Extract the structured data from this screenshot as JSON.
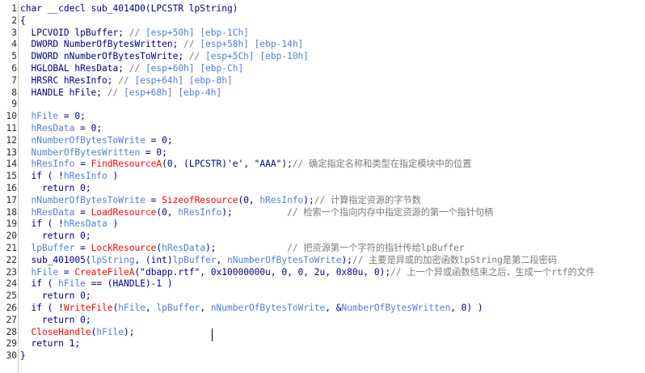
{
  "editor": {
    "lines": [
      "char __cdecl sub_4014D0(LPCSTR lpString)",
      "{",
      "  LPCVOID lpBuffer; // [esp+50h] [ebp-1Ch]",
      "  DWORD NumberOfBytesWritten; // [esp+58h] [ebp-14h]",
      "  DWORD nNumberOfBytesToWrite; // [esp+5Ch] [ebp-10h]",
      "  HGLOBAL hResData; // [esp+60h] [ebp-Ch]",
      "  HRSRC hResInfo; // [esp+64h] [ebp-8h]",
      "  HANDLE hFile; // [esp+68h] [ebp-4h]",
      "",
      "  hFile = 0;",
      "  hResData = 0;",
      "  nNumberOfBytesToWrite = 0;",
      "  NumberOfBytesWritten = 0;",
      "  hResInfo = FindResourceA(0, (LPCSTR)'e', \"AAA\");// 确定指定名称和类型在指定模块中的位置",
      "  if ( !hResInfo )",
      "    return 0;",
      "  nNumberOfBytesToWrite = SizeofResource(0, hResInfo);// 计算指定资源的字节数",
      "  hResData = LoadResource(0, hResInfo);          // 检索一个指向内存中指定资源的第一个指针句柄",
      "  if ( !hResData )",
      "    return 0;",
      "  lpBuffer = LockResource(hResData);             // 把资源第一个字符的指针传给lpBuffer",
      "  sub_401005(lpString, (int)lpBuffer, nNumberOfBytesToWrite);// 主要是异或的加密函数lpString是第二段密码",
      "  hFile = CreateFileA(\"dbapp.rtf\", 0x10000000u, 0, 0, 2u, 0x80u, 0);// 上一个异或函数结束之后，生成一个rtf的文件",
      "  if ( hFile == (HANDLE)-1 )",
      "    return 0;",
      "  if ( !WriteFile(hFile, lpBuffer, nNumberOfBytesToWrite, &NumberOfBytesWritten, 0) )",
      "    return 0;",
      "  CloseHandle(hFile);",
      "  return 1;",
      "}"
    ],
    "line_numbers": [
      "1",
      "2",
      "3",
      "4",
      "5",
      "6",
      "7",
      "8",
      "9",
      "10",
      "11",
      "12",
      "13",
      "14",
      "15",
      "16",
      "17",
      "18",
      "19",
      "20",
      "21",
      "22",
      "23",
      "24",
      "25",
      "26",
      "27",
      "28",
      "29",
      "30"
    ]
  },
  "colors": {
    "background": "#ffffff",
    "text": "#000080",
    "variable": "#4f7fd6",
    "comment": "#7a7a7a",
    "function": "#ff0000",
    "gutter_border": "#c8c8c8"
  }
}
